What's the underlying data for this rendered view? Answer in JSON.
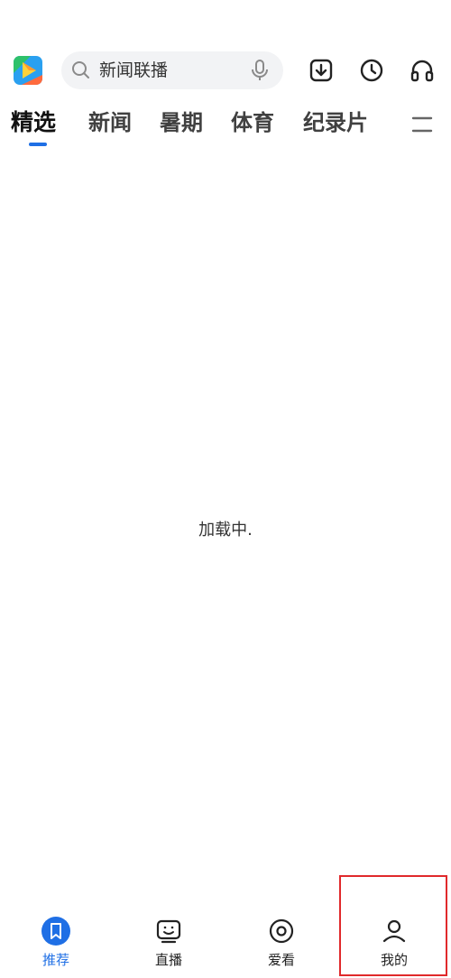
{
  "colors": {
    "accent": "#1f6fe5",
    "highlight": "#e0292b",
    "search_bg": "#f2f3f5"
  },
  "header": {
    "logo_icon": "app-play-logo",
    "search": {
      "icon": "search-icon",
      "text": "新闻联播",
      "mic_icon": "microphone-icon"
    },
    "actions": [
      "download-icon",
      "history-clock-icon",
      "headphones-icon"
    ]
  },
  "tabs": {
    "items": [
      {
        "label": "精选",
        "active": true
      },
      {
        "label": "新闻",
        "active": false
      },
      {
        "label": "暑期",
        "active": false
      },
      {
        "label": "体育",
        "active": false
      },
      {
        "label": "纪录片",
        "active": false
      }
    ],
    "menu_icon": "menu-icon"
  },
  "content": {
    "loading_text": "加载中."
  },
  "bottom_nav": {
    "items": [
      {
        "label": "推荐",
        "icon": "bookmark-icon",
        "active": true
      },
      {
        "label": "直播",
        "icon": "tv-icon",
        "active": false
      },
      {
        "label": "爱看",
        "icon": "disc-icon",
        "active": false
      },
      {
        "label": "我的",
        "icon": "user-icon",
        "active": false
      }
    ]
  }
}
